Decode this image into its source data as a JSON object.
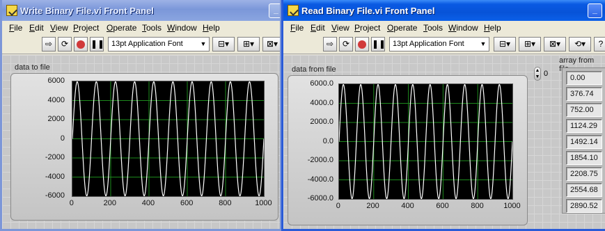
{
  "windows": [
    {
      "title": "Write Binary File.vi Front Panel",
      "menu": [
        "File",
        "Edit",
        "View",
        "Project",
        "Operate",
        "Tools",
        "Window",
        "Help"
      ],
      "font_selector": "13pt Application Font",
      "graph": {
        "label": "data to file",
        "y_ticks": [
          "6000",
          "4000",
          "2000",
          "0",
          "-2000",
          "-4000",
          "-6000"
        ],
        "x_ticks": [
          "0",
          "200",
          "400",
          "600",
          "800",
          "1000"
        ]
      }
    },
    {
      "title": "Read Binary File.vi Front Panel",
      "menu": [
        "File",
        "Edit",
        "View",
        "Project",
        "Operate",
        "Tools",
        "Window",
        "Help"
      ],
      "font_selector": "13pt Application Font",
      "graph": {
        "label": "data from file",
        "y_ticks": [
          "6000.0",
          "4000.0",
          "2000.0",
          "0.0",
          "-2000.0",
          "-4000.0",
          "-6000.0"
        ],
        "x_ticks": [
          "0",
          "200",
          "400",
          "600",
          "800",
          "1000"
        ]
      },
      "array": {
        "label": "array from file",
        "index": "0",
        "values": [
          "0.00",
          "376.74",
          "752.00",
          "1124.29",
          "1492.14",
          "1854.10",
          "2208.75",
          "2554.68",
          "2890.52"
        ]
      }
    }
  ],
  "chart_data": [
    {
      "type": "line",
      "title": "data to file",
      "xlim": [
        0,
        1000
      ],
      "ylim": [
        -6000,
        6000
      ],
      "series": [
        {
          "amplitude": 6000,
          "period": 100,
          "phase": "sine starting at 0"
        }
      ],
      "grid": true,
      "trace_color": "#ffffff",
      "grid_color": "#1d8a1d",
      "background": "#000000"
    },
    {
      "type": "line",
      "title": "data from file",
      "xlim": [
        0,
        1000
      ],
      "ylim": [
        -6000,
        6000
      ],
      "series": [
        {
          "amplitude": 6000,
          "period": 100,
          "phase": "sine starting at 0"
        }
      ],
      "grid": true,
      "trace_color": "#ffffff",
      "grid_color": "#1d8a1d",
      "background": "#000000"
    }
  ]
}
